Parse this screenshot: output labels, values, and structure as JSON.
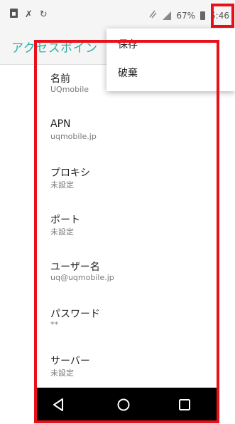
{
  "status_bar": {
    "left_icons": [
      "sim-card-icon",
      "tools-icon",
      "sync-icon"
    ],
    "battery_text": "67%",
    "time": "5:46"
  },
  "app_bar": {
    "title": "アクセスポイン"
  },
  "overflow_menu": {
    "items": [
      {
        "label": "保存"
      },
      {
        "label": "破棄"
      }
    ]
  },
  "settings": {
    "items": [
      {
        "title": "名前",
        "summary": "UQmobile"
      },
      {
        "title": "APN",
        "summary": "uqmobile.jp"
      },
      {
        "title": "プロキシ",
        "summary": "未設定"
      },
      {
        "title": "ポート",
        "summary": "未設定"
      },
      {
        "title": "ユーザー名",
        "summary": "uq@uqmobile.jp"
      },
      {
        "title": "パスワード",
        "summary": "**"
      },
      {
        "title": "サーバー",
        "summary": "未設定"
      }
    ]
  },
  "nav_bar": {
    "buttons": [
      "back-icon",
      "home-icon",
      "recents-icon"
    ]
  }
}
